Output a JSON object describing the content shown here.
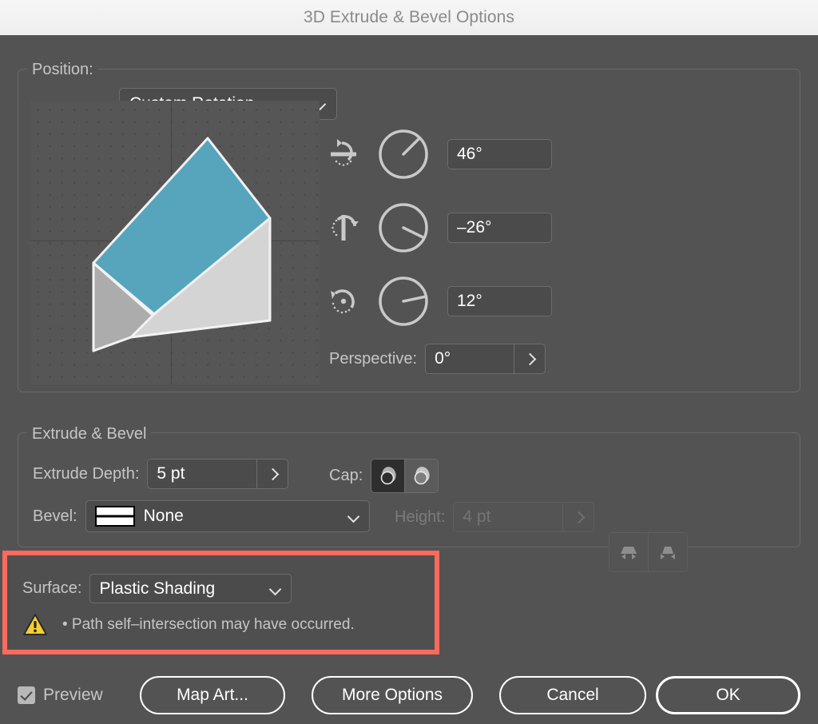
{
  "titlebar": {
    "title": "3D Extrude & Bevel Options"
  },
  "position": {
    "label": "Position:",
    "value": "Custom Rotation",
    "chevron_icon": "chevron-down-icon"
  },
  "preview_stage": {
    "shape": "cube",
    "top_face_color": "#56a5bd",
    "right_face_color": "#d4d4d4",
    "left_face_color": "#acacac",
    "edge_color": "#f2f2f2",
    "background_color": "#565656",
    "grid_dot_color": "#4a4a4a",
    "axis_color": "#454545"
  },
  "rotation": [
    {
      "axis": "x",
      "icon": "rotate-x-axis-icon",
      "value": "46°",
      "needle_deg": 46
    },
    {
      "axis": "y",
      "icon": "rotate-y-axis-icon",
      "value": "–26°",
      "needle_deg": -26
    },
    {
      "axis": "z",
      "icon": "rotate-z-axis-icon",
      "value": "12°",
      "needle_deg": 12
    }
  ],
  "perspective": {
    "label": "Perspective:",
    "value": "0°",
    "arrow_icon": "chevron-right-icon"
  },
  "extrude_group": {
    "legend": "Extrude & Bevel",
    "depth_label": "Extrude Depth:",
    "depth_value": "5 pt",
    "depth_arrow_icon": "chevron-right-icon",
    "cap_label": "Cap:",
    "cap_options": [
      {
        "name": "cap-solid",
        "selected": true
      },
      {
        "name": "cap-hollow",
        "selected": false
      }
    ],
    "bevel_label": "Bevel:",
    "bevel_value": "None",
    "bevel_swatch_icon": "bevel-none-swatch-icon",
    "bevel_chevron_icon": "chevron-down-icon",
    "height_label": "Height:",
    "height_value": "4 pt",
    "height_disabled": true,
    "height_arrow_icon": "chevron-right-icon",
    "bevel_extent_options": [
      {
        "name": "bevel-extent-out",
        "selected": false
      },
      {
        "name": "bevel-extent-in",
        "selected": false
      }
    ]
  },
  "surface": {
    "label": "Surface:",
    "value": "Plastic Shading",
    "chevron_icon": "chevron-down-icon",
    "highlight_color": "#fc6a5d",
    "warning_icon": "warning-triangle-icon",
    "warning_text": "• Path self–intersection may have occurred."
  },
  "footer": {
    "preview_label": "Preview",
    "preview_checked": true,
    "map_art_label": "Map Art...",
    "more_options_label": "More Options",
    "cancel_label": "Cancel",
    "ok_label": "OK"
  }
}
